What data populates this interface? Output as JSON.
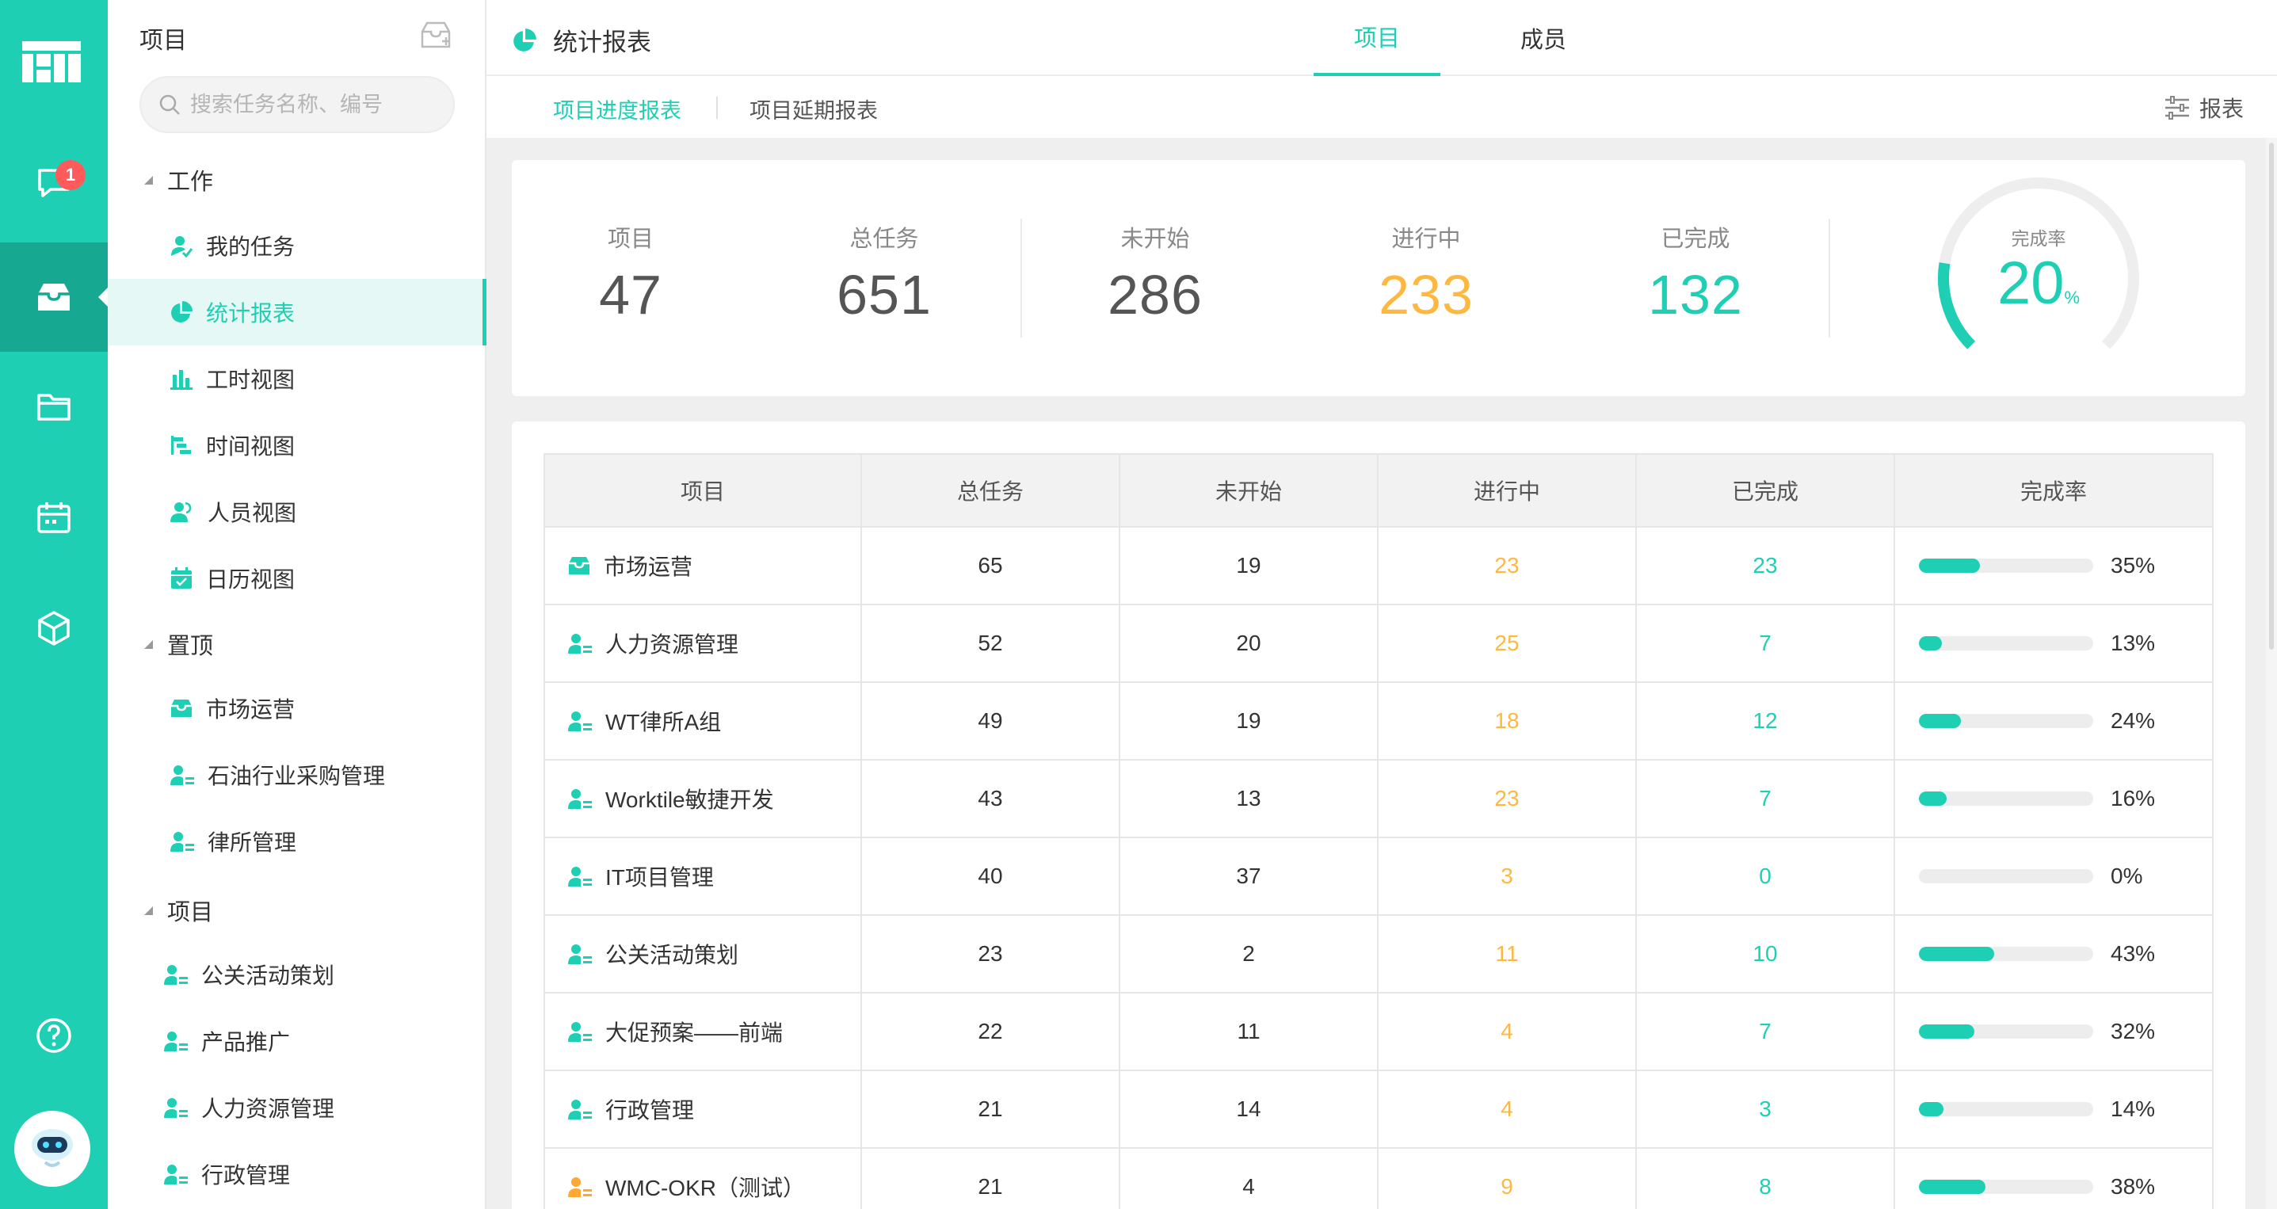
{
  "rail": {
    "badge_count": "1",
    "items": [
      {
        "icon": "chat-icon"
      },
      {
        "icon": "inbox-icon",
        "active": true
      },
      {
        "icon": "folder-icon"
      },
      {
        "icon": "calendar-icon"
      },
      {
        "icon": "cube-icon"
      },
      {
        "icon": "help-icon"
      }
    ]
  },
  "sidebar": {
    "title": "项目",
    "search_placeholder": "搜索任务名称、编号",
    "sections": {
      "work": "工作",
      "pinned": "置顶",
      "projects": "项目"
    },
    "work_items": [
      "我的任务",
      "统计报表",
      "工时视图",
      "时间视图",
      "人员视图",
      "日历视图"
    ],
    "pinned_items": [
      "市场运营",
      "石油行业采购管理",
      "律所管理"
    ],
    "project_items": [
      "公关活动策划",
      "产品推广",
      "人力资源管理",
      "行政管理"
    ]
  },
  "header": {
    "title": "统计报表",
    "tabs": [
      "项目",
      "成员"
    ],
    "active_tab": "项目",
    "subtabs": [
      "项目进度报表",
      "项目延期报表"
    ],
    "report_button": "报表"
  },
  "summary": {
    "projects_label": "项目",
    "projects": "47",
    "total_label": "总任务",
    "total": "651",
    "not_started_label": "未开始",
    "not_started": "286",
    "in_progress_label": "进行中",
    "in_progress": "233",
    "done_label": "已完成",
    "done": "132",
    "rate_label": "完成率",
    "rate": "20",
    "rate_unit": "%",
    "rate_value": 0.2
  },
  "table": {
    "headers": [
      "项目",
      "总任务",
      "未开始",
      "进行中",
      "已完成",
      "完成率"
    ],
    "rows": [
      {
        "name": "市场运营",
        "total": "65",
        "not_started": "19",
        "in_progress": "23",
        "done": "23",
        "rate": "35%",
        "rate_value": 0.35,
        "icon": "inbox-icon"
      },
      {
        "name": "人力资源管理",
        "total": "52",
        "not_started": "20",
        "in_progress": "25",
        "done": "7",
        "rate": "13%",
        "rate_value": 0.13,
        "icon": "project-member-icon"
      },
      {
        "name": "WT律所A组",
        "total": "49",
        "not_started": "19",
        "in_progress": "18",
        "done": "12",
        "rate": "24%",
        "rate_value": 0.24,
        "icon": "project-member-icon"
      },
      {
        "name": "Worktile敏捷开发",
        "total": "43",
        "not_started": "13",
        "in_progress": "23",
        "done": "7",
        "rate": "16%",
        "rate_value": 0.16,
        "icon": "project-member-icon"
      },
      {
        "name": "IT项目管理",
        "total": "40",
        "not_started": "37",
        "in_progress": "3",
        "done": "0",
        "rate": "0%",
        "rate_value": 0.0,
        "icon": "project-member-icon"
      },
      {
        "name": "公关活动策划",
        "total": "23",
        "not_started": "2",
        "in_progress": "11",
        "done": "10",
        "rate": "43%",
        "rate_value": 0.43,
        "icon": "project-member-icon"
      },
      {
        "name": "大促预案——前端",
        "total": "22",
        "not_started": "11",
        "in_progress": "4",
        "done": "7",
        "rate": "32%",
        "rate_value": 0.32,
        "icon": "project-member-icon"
      },
      {
        "name": "行政管理",
        "total": "21",
        "not_started": "14",
        "in_progress": "4",
        "done": "3",
        "rate": "14%",
        "rate_value": 0.14,
        "icon": "project-member-icon"
      },
      {
        "name": "WMC-OKR（测试）",
        "total": "21",
        "not_started": "4",
        "in_progress": "9",
        "done": "8",
        "rate": "38%",
        "rate_value": 0.38,
        "icon": "project-member-icon-orange"
      }
    ]
  },
  "colors": {
    "accent": "#1fcfb4",
    "orange": "#ffb83f",
    "badge": "#ff5b5b"
  }
}
